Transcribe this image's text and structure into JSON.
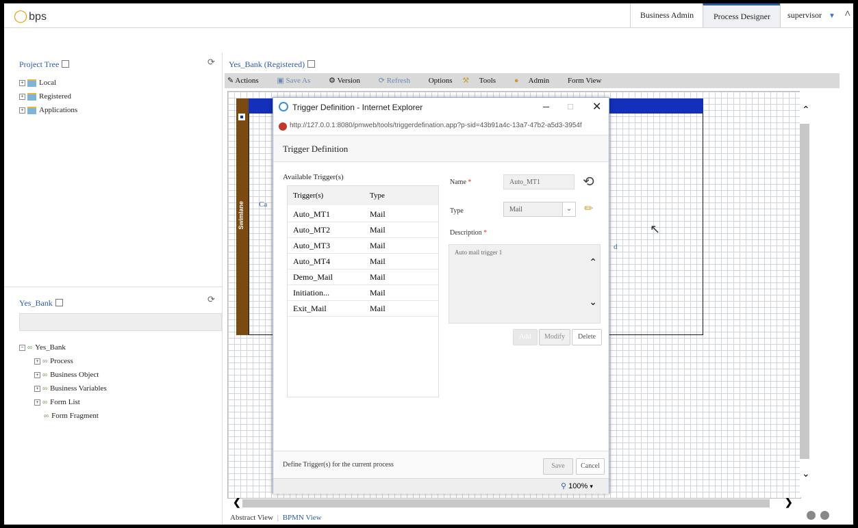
{
  "app": {
    "logo": "bps"
  },
  "top_tabs": [
    {
      "label": "Business Admin"
    },
    {
      "label": "Process Designer"
    },
    {
      "label": "supervisor"
    }
  ],
  "project_tree": {
    "title": "Project Tree",
    "items": [
      {
        "label": "Local"
      },
      {
        "label": "Registered"
      },
      {
        "label": "Applications"
      }
    ]
  },
  "yes_bank_panel": {
    "title": "Yes_Bank",
    "root": "Yes_Bank",
    "children": [
      {
        "label": "Process"
      },
      {
        "label": "Business Object"
      },
      {
        "label": "Business Variables"
      },
      {
        "label": "Form List"
      },
      {
        "label": "Form Fragment"
      }
    ]
  },
  "editor": {
    "title": "Yes_Bank (Registered)",
    "toolbar": {
      "actions": "Actions",
      "save_as": "Save As",
      "version": "Version",
      "refresh": "Refresh",
      "options": "Options",
      "tools": "Tools",
      "admin": "Admin",
      "form_view": "Form View"
    },
    "swimlane": "Swimlane",
    "lane_text_1": "Ca",
    "lane_text_2": "d",
    "bottom_tabs": {
      "abstract": "Abstract View",
      "bpmn": "BPMN View"
    }
  },
  "dialog": {
    "window_title": "Trigger Definition - Internet Explorer",
    "url": "http://127.0.0.1:8080/pmweb/tools/triggerdefination.app?p-sid=43b91a4c-13a7-47b2-a5d3-3954f",
    "heading": "Trigger Definition",
    "available_label": "Available Trigger(s)",
    "col_trigger": "Trigger(s)",
    "col_type": "Type",
    "rows": [
      {
        "name": "Auto_MT1",
        "type": "Mail"
      },
      {
        "name": "Auto_MT2",
        "type": "Mail"
      },
      {
        "name": "Auto_MT3",
        "type": "Mail"
      },
      {
        "name": "Auto_MT4",
        "type": "Mail"
      },
      {
        "name": "Demo_Mail",
        "type": "Mail"
      },
      {
        "name": "Initiation...",
        "type": "Mail"
      },
      {
        "name": "Exit_Mail",
        "type": "Mail"
      }
    ],
    "name_label": "Name",
    "name_value": "Auto_MT1",
    "type_label": "Type",
    "type_value": "Mail",
    "description_label": "Description",
    "description_value": "Auto mail trigger 1",
    "required_mark": "*",
    "btn_add": "Add",
    "btn_modify": "Modify",
    "btn_delete": "Delete",
    "footer_text": "Define Trigger(s) for the current process",
    "btn_save": "Save",
    "btn_cancel": "Cancel",
    "zoom": "100%"
  },
  "colors": {
    "accent": "#2a5caa",
    "lane": "#7a4a10",
    "lane_header": "#1530b8"
  }
}
